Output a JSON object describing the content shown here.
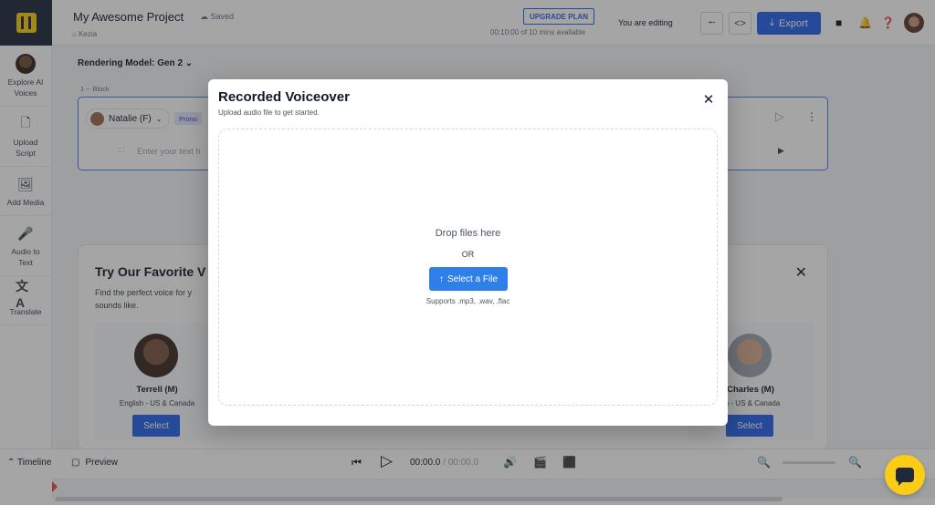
{
  "app": {
    "project_title": "My Awesome Project",
    "saved_status": "Saved",
    "breadcrumb": "Kezia",
    "upgrade_label": "UPGRADE PLAN",
    "time_available": "00:10:00 of 10 mins available",
    "editing_status": "You are editing",
    "export_label": "Export",
    "brand_color": "#2563eb",
    "logo_color": "#facc15"
  },
  "sidebar": {
    "items": [
      {
        "label": "Explore AI Voices",
        "icon": "voice-avatar-icon"
      },
      {
        "label": "Upload Script",
        "icon": "upload-script-icon"
      },
      {
        "label": "Add Media",
        "icon": "add-media-icon"
      },
      {
        "label": "Audio to Text",
        "icon": "audio-to-text-icon"
      },
      {
        "label": "Translate",
        "icon": "translate-icon"
      }
    ]
  },
  "editor": {
    "rendering_model": "Rendering Model: Gen 2",
    "block_label": "1 -- Block",
    "voice_name": "Natalie (F)",
    "pron_chip": "Prono",
    "input_placeholder": "Enter your text h"
  },
  "favorites": {
    "title": "Try Our Favorite V",
    "subtitle": "Find the perfect voice for y sounds like.",
    "voices": [
      {
        "name": "Terrell (M)",
        "lang": "English - US & Canada",
        "select": "Select"
      },
      {
        "name": "Charles (M)",
        "lang": "sh - US & Canada",
        "select": "Select"
      }
    ]
  },
  "timeline": {
    "toggle_label": "Timeline",
    "preview_label": "Preview",
    "current_time": "00:00.0",
    "total_time": "/ 00:00.0"
  },
  "modal": {
    "title": "Recorded Voiceover",
    "subtitle": "Upload audio file to get started.",
    "drop_text": "Drop files here",
    "or_text": "OR",
    "select_label": "Select a File",
    "supports_text": "Supports .mp3, .wav, .flac"
  }
}
